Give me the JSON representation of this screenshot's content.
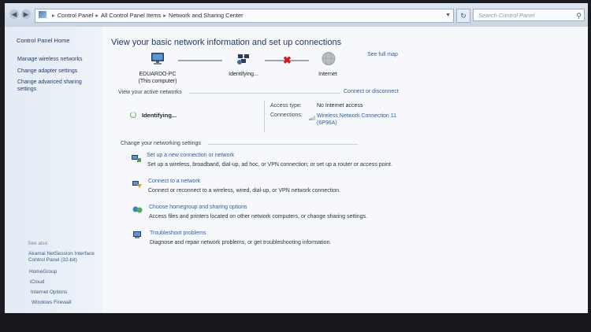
{
  "address_bar": {
    "breadcrumbs": [
      "Control Panel",
      "All Control Panel Items",
      "Network and Sharing Center"
    ],
    "search_placeholder": "Search Control Panel"
  },
  "sidebar": {
    "home": "Control Panel Home",
    "links": [
      {
        "label": "Manage wireless networks"
      },
      {
        "label": "Change adapter settings"
      },
      {
        "label": "Change advanced sharing settings"
      }
    ],
    "see_also_title": "See also",
    "see_also": [
      {
        "label": "Akamai NetSession Interface Control Panel (32-bit)"
      },
      {
        "label": "HomeGroup"
      },
      {
        "label": "iCloud"
      },
      {
        "label": "Internet Options"
      },
      {
        "label": "Windows Firewall"
      }
    ]
  },
  "main": {
    "heading": "View your basic network information and set up connections",
    "see_full_map": "See full map",
    "map": {
      "computer_name": "EDUARDO-PC",
      "computer_sub": "(This computer)",
      "middle": "Identifying...",
      "internet": "Internet"
    },
    "active_networks_label": "View your active networks",
    "connect_disconnect": "Connect or disconnect",
    "network_status": "Identifying...",
    "access_type_key": "Access type:",
    "access_type_value": "No Internet access",
    "connections_key": "Connections:",
    "connection_name": "Wireless Network Connection 11",
    "connection_ssid": "(6P96A)",
    "change_settings_label": "Change your networking settings",
    "tasks": [
      {
        "title": "Set up a new connection or network",
        "desc": "Set up a wireless, broadband, dial-up, ad hoc, or VPN connection; or set up a router or access point."
      },
      {
        "title": "Connect to a network",
        "desc": "Connect or reconnect to a wireless, wired, dial-up, or VPN network connection."
      },
      {
        "title": "Choose homegroup and sharing options",
        "desc": "Access files and printers located on other network computers, or change sharing settings."
      },
      {
        "title": "Troubleshoot problems",
        "desc": "Diagnose and repair network problems, or get troubleshooting information."
      }
    ]
  },
  "colors": {
    "link": "#2a5fa8",
    "error_x": "#d81818",
    "sidebar_bg": "#e4ebf5"
  }
}
